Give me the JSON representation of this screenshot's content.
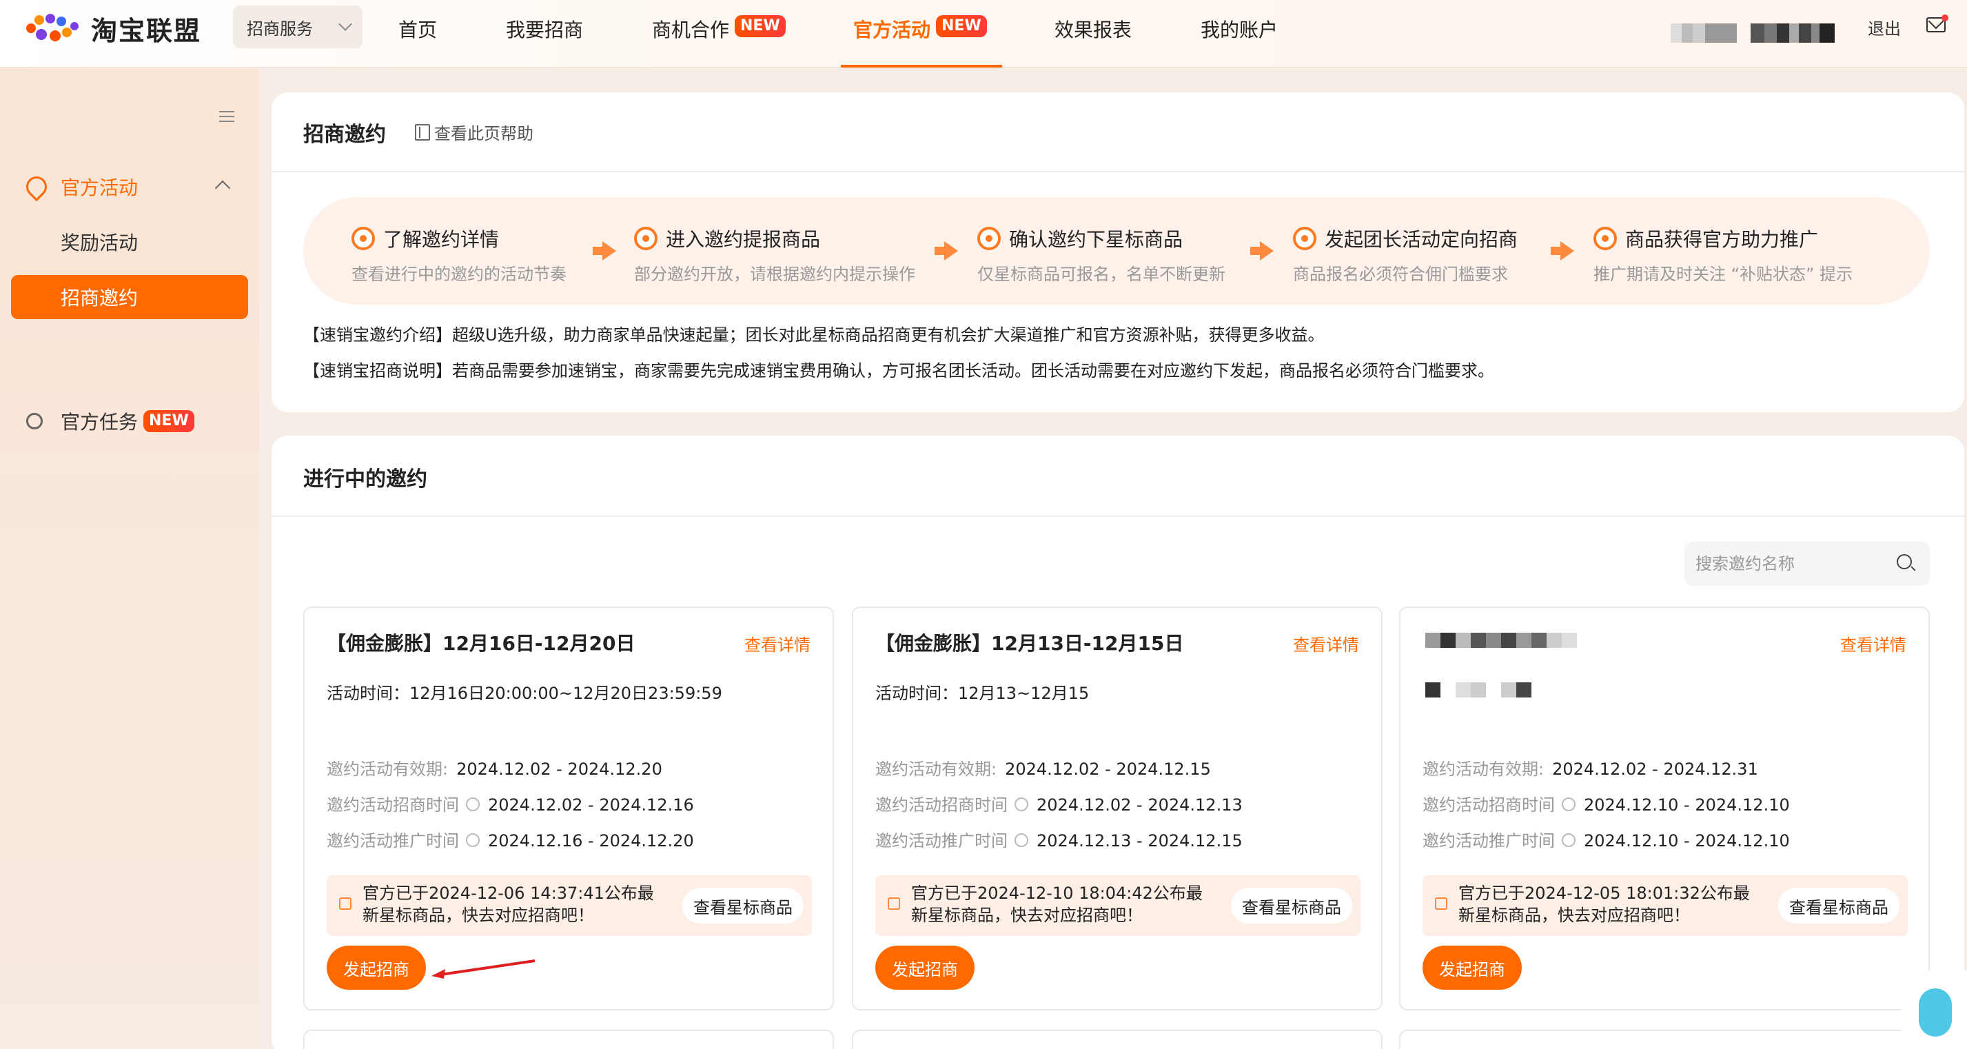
{
  "header": {
    "logo_text": "淘宝联盟",
    "service_label": "招商服务",
    "nav": [
      {
        "label": "首页"
      },
      {
        "label": "我要招商"
      },
      {
        "label": "商机合作",
        "badge": "NEW"
      },
      {
        "label": "官方活动",
        "badge": "NEW",
        "active": true
      },
      {
        "label": "效果报表"
      },
      {
        "label": "我的账户"
      }
    ],
    "logout_label": "退出"
  },
  "sidebar": {
    "group_label": "官方活动",
    "items": [
      {
        "label": "奖励活动"
      },
      {
        "label": "招商邀约",
        "active": true
      }
    ],
    "task_label": "官方任务",
    "task_badge": "NEW"
  },
  "guide": {
    "title": "招商邀约",
    "help_label": "查看此页帮助",
    "steps": [
      {
        "title": "了解邀约详情",
        "desc": "查看进行中的邀约的活动节奏"
      },
      {
        "title": "进入邀约提报商品",
        "desc": "部分邀约开放，请根据邀约内提示操作"
      },
      {
        "title": "确认邀约下星标商品",
        "desc": "仅星标商品可报名，名单不断更新"
      },
      {
        "title": "发起团长活动定向招商",
        "desc": "商品报名必须符合佣门槛要求"
      },
      {
        "title": "商品获得官方助力推广",
        "desc": "推广期请及时关注 “补贴状态” 提示"
      }
    ],
    "intro1": "【速销宝邀约介绍】超级U选升级，助力商家单品快速起量；团长对此星标商品招商更有机会扩大渠道推广和官方资源补贴，获得更多收益。",
    "intro2": "【速销宝招商说明】若商品需要参加速销宝，商家需要先完成速销宝费用确认，方可报名团长活动。团长活动需要在对应邀约下发起，商品报名必须符合门槛要求。"
  },
  "ongoing": {
    "title": "进行中的邀约",
    "search_placeholder": "搜索邀约名称",
    "labels": {
      "detail": "查看详情",
      "time_prefix": "活动时间：",
      "valid": "邀约活动有效期:",
      "recruit": "邀约活动招商时间",
      "promo": "邀约活动推广时间",
      "star_btn": "查看星标商品",
      "launch": "发起招商"
    },
    "cards": [
      {
        "title": "【佣金膨胀】12月16日-12月20日",
        "time": "12月16日20:00:00~12月20日23:59:59",
        "valid": "2024.12.02 - 2024.12.20",
        "recruit": "2024.12.02 - 2024.12.16",
        "promo": "2024.12.16 - 2024.12.20",
        "notice": "官方已于2024-12-06 14:37:41公布最新星标商品，快去对应招商吧！"
      },
      {
        "title": "【佣金膨胀】12月13日-12月15日",
        "time": "12月13~12月15",
        "valid": "2024.12.02 - 2024.12.15",
        "recruit": "2024.12.02 - 2024.12.13",
        "promo": "2024.12.13 - 2024.12.15",
        "notice": "官方已于2024-12-10 18:04:42公布最新星标商品，快去对应招商吧！"
      },
      {
        "title": "",
        "time": "",
        "valid": "2024.12.02 - 2024.12.31",
        "recruit": "2024.12.10 - 2024.12.10",
        "promo": "2024.12.10 - 2024.12.10",
        "notice": "官方已于2024-12-05 18:01:32公布最新星标商品，快去对应招商吧！"
      }
    ]
  },
  "colors": {
    "accent": "#ff6a00",
    "notice_bg": "#fdeee6",
    "sidebar_bg": "#fbe5d4"
  },
  "icons": [
    "logo-icon",
    "chevron-down-icon",
    "mail-icon",
    "menu-icon",
    "activity-icon",
    "chevron-up-icon",
    "task-icon",
    "book-icon",
    "search-icon",
    "info-icon",
    "speaker-icon",
    "arrow-right-icon",
    "mascot-icon"
  ]
}
